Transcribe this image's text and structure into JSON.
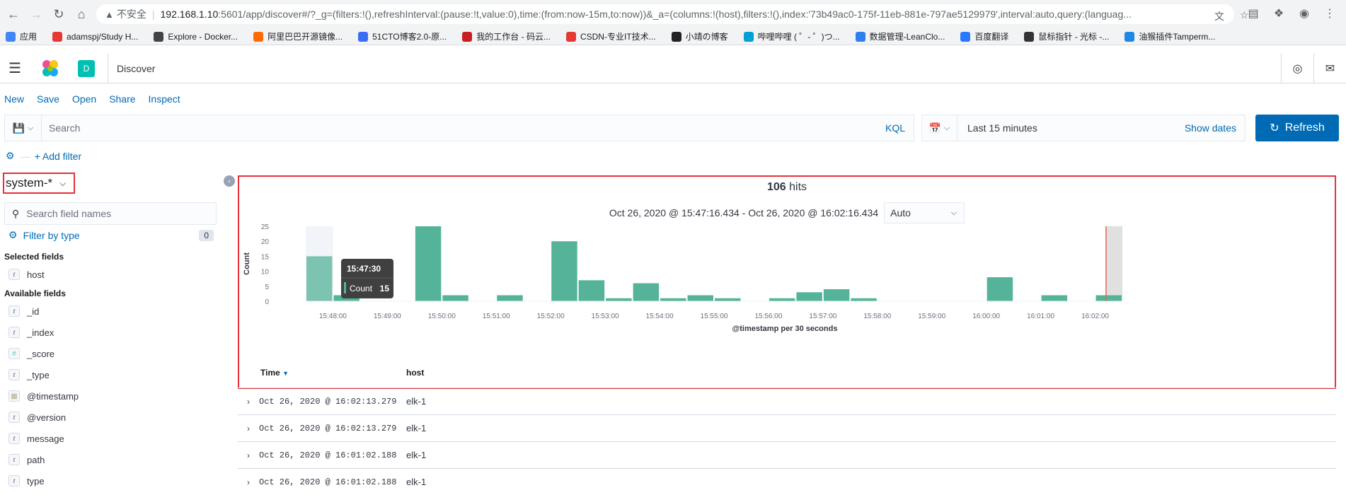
{
  "browser": {
    "insecure_label": "不安全",
    "url_host": "192.168.1.10",
    "url_rest": ":5601/app/discover#/?_g=(filters:!(),refreshInterval:(pause:!t,value:0),time:(from:now-15m,to:now))&_a=(columns:!(host),filters:!(),index:'73b49ac0-175f-11eb-881e-797ae5129979',interval:auto,query:(languag...",
    "bookmarks": [
      {
        "label": "应用",
        "color": "#4285f4"
      },
      {
        "label": "adamspj/Study H...",
        "color": "#e53935"
      },
      {
        "label": "Explore - Docker...",
        "color": "#444"
      },
      {
        "label": "阿里巴巴开源镜像...",
        "color": "#ff6a00"
      },
      {
        "label": "51CTO博客2.0-原...",
        "color": "#3b6ef5"
      },
      {
        "label": "我的工作台 - 码云...",
        "color": "#c71d23"
      },
      {
        "label": "CSDN-专业IT技术...",
        "color": "#e53935"
      },
      {
        "label": "小靖の博客",
        "color": "#222"
      },
      {
        "label": "哔哩哔哩 ( ゜- ゜)つ...",
        "color": "#00a1d6"
      },
      {
        "label": "数据管理-LeanClo...",
        "color": "#2f7ff0"
      },
      {
        "label": "百度翻译",
        "color": "#2979ff"
      },
      {
        "label": "鼠标指针 - 光标 -...",
        "color": "#333"
      },
      {
        "label": "油猴插件Tamperm...",
        "color": "#1e88e5"
      }
    ]
  },
  "header": {
    "space_initial": "D",
    "app_title": "Discover"
  },
  "top_nav": [
    "New",
    "Save",
    "Open",
    "Share",
    "Inspect"
  ],
  "query": {
    "placeholder": "Search",
    "language": "KQL"
  },
  "date_picker": {
    "range": "Last 15 minutes",
    "show_dates": "Show dates"
  },
  "refresh_label": "Refresh",
  "add_filter": "+ Add filter",
  "sidebar": {
    "index_pattern": "system-*",
    "search_placeholder": "Search field names",
    "filter_by_type": "Filter by type",
    "filter_count": "0",
    "selected_title": "Selected fields",
    "selected_fields": [
      {
        "name": "host",
        "type": "t"
      }
    ],
    "available_title": "Available fields",
    "available_fields": [
      {
        "name": "_id",
        "type": "t"
      },
      {
        "name": "_index",
        "type": "t"
      },
      {
        "name": "_score",
        "type": "#"
      },
      {
        "name": "_type",
        "type": "t"
      },
      {
        "name": "@timestamp",
        "type": "date"
      },
      {
        "name": "@version",
        "type": "t"
      },
      {
        "name": "message",
        "type": "t"
      },
      {
        "name": "path",
        "type": "t"
      },
      {
        "name": "type",
        "type": "t"
      }
    ]
  },
  "hits": {
    "count": "106",
    "label": "hits",
    "range": "Oct 26, 2020 @ 15:47:16.434 - Oct 26, 2020 @ 16:02:16.434",
    "interval": "Auto"
  },
  "chart_data": {
    "type": "bar",
    "xlabel": "@timestamp per 30 seconds",
    "ylabel": "Count",
    "ylim": [
      0,
      25
    ],
    "yticks": [
      0,
      5,
      10,
      15,
      20,
      25
    ],
    "xtick_labels": [
      "15:48:00",
      "15:49:00",
      "15:50:00",
      "15:51:00",
      "15:52:00",
      "15:53:00",
      "15:54:00",
      "15:55:00",
      "15:56:00",
      "15:57:00",
      "15:58:00",
      "15:59:00",
      "16:00:00",
      "16:01:00",
      "16:02:00"
    ],
    "values": [
      15,
      2,
      0,
      0,
      25,
      2,
      0,
      2,
      0,
      20,
      7,
      1,
      6,
      1,
      2,
      1,
      0,
      1,
      3,
      4,
      1,
      0,
      0,
      0,
      0,
      8,
      0,
      2,
      0,
      2
    ],
    "bar_color": "#54b399",
    "tooltip": {
      "time": "15:47:30",
      "label": "Count",
      "value": "15"
    }
  },
  "table": {
    "columns": [
      "Time",
      "host"
    ],
    "rows": [
      {
        "time": "Oct 26, 2020 @ 16:02:13.279",
        "host": "elk-1"
      },
      {
        "time": "Oct 26, 2020 @ 16:02:13.279",
        "host": "elk-1"
      },
      {
        "time": "Oct 26, 2020 @ 16:01:02.188",
        "host": "elk-1"
      },
      {
        "time": "Oct 26, 2020 @ 16:01:02.188",
        "host": "elk-1"
      }
    ]
  }
}
